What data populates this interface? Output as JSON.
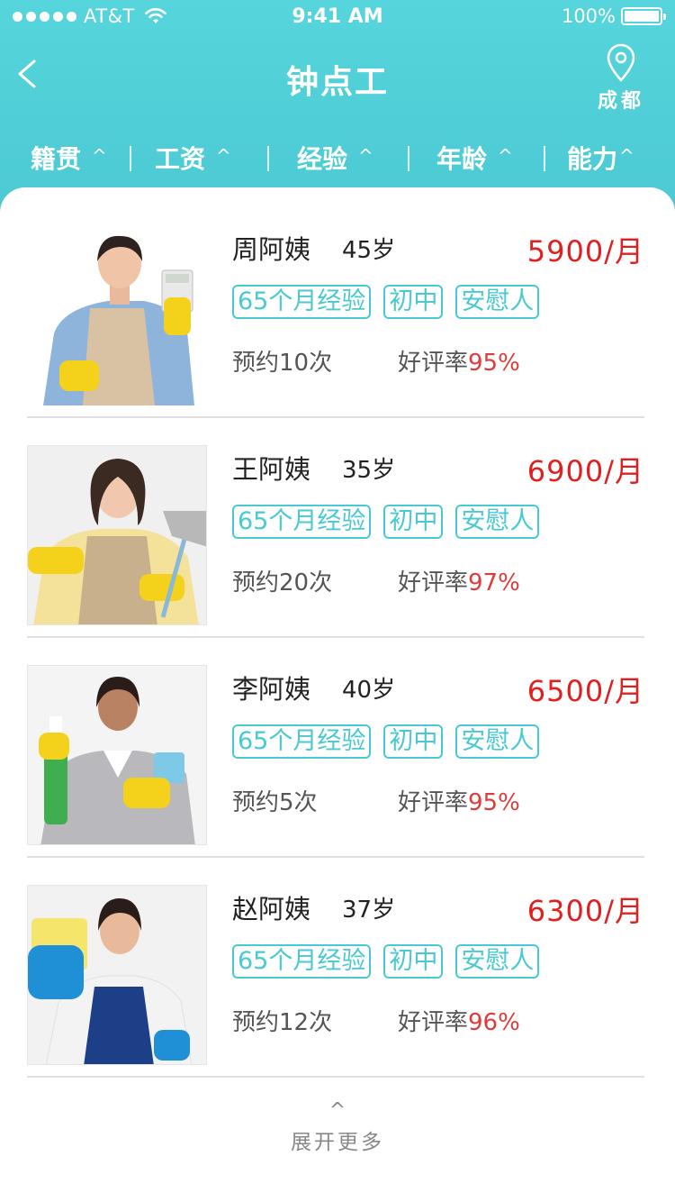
{
  "status_bar": {
    "carrier": "AT&T",
    "time": "9:41 AM",
    "battery": "100%"
  },
  "nav": {
    "title": "钟点工",
    "city": "成都"
  },
  "filters": [
    {
      "label": "籍贯",
      "caret": "^"
    },
    {
      "label": "工资",
      "caret": "^"
    },
    {
      "label": "经验",
      "caret": "^"
    },
    {
      "label": "年龄",
      "caret": "^"
    },
    {
      "label": "能力",
      "caret": "^"
    }
  ],
  "workers": [
    {
      "name": "周阿姨",
      "age": "45岁",
      "salary": "5900/月",
      "tags": [
        "65个月经验",
        "初中",
        "安慰人"
      ],
      "bookings": "预约10次",
      "rating_label": "好评率",
      "rating_value": "95%"
    },
    {
      "name": "王阿姨",
      "age": "35岁",
      "salary": "6900/月",
      "tags": [
        "65个月经验",
        "初中",
        "安慰人"
      ],
      "bookings": "预约20次",
      "rating_label": "好评率",
      "rating_value": "97%"
    },
    {
      "name": "李阿姨",
      "age": "40岁",
      "salary": "6500/月",
      "tags": [
        "65个月经验",
        "初中",
        "安慰人"
      ],
      "bookings": "预约5次",
      "rating_label": "好评率",
      "rating_value": "95%"
    },
    {
      "name": "赵阿姨",
      "age": "37岁",
      "salary": "6300/月",
      "tags": [
        "65个月经验",
        "初中",
        "安慰人"
      ],
      "bookings": "预约12次",
      "rating_label": "好评率",
      "rating_value": "96%"
    }
  ],
  "expand": {
    "caret": "^",
    "label": "展开更多"
  },
  "colors": {
    "header": "#56d5dc",
    "accent": "#49c9d1",
    "price": "#e21f1f",
    "rating": "#e03a3a"
  }
}
